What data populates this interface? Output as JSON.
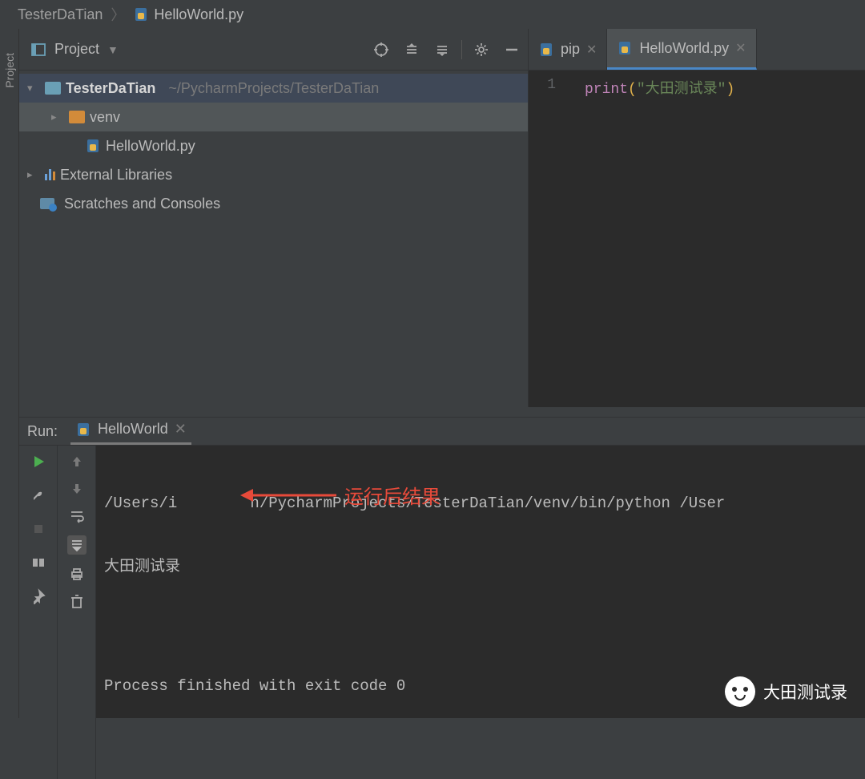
{
  "breadcrumb": {
    "root": "TesterDaTian",
    "file": "HelloWorld.py"
  },
  "leftRail": {
    "label": "Project"
  },
  "projectToolbar": {
    "title": "Project"
  },
  "tree": {
    "root": {
      "name": "TesterDaTian",
      "path": "~/PycharmProjects/TesterDaTian"
    },
    "venv": "venv",
    "file": "HelloWorld.py",
    "external": "External Libraries",
    "scratches": "Scratches and Consoles"
  },
  "editor": {
    "tabs": [
      {
        "label": "pip"
      },
      {
        "label": "HelloWorld.py"
      }
    ],
    "lineNo": "1",
    "code": {
      "fn": "print",
      "lp": "(",
      "str": "\"大田测试录\"",
      "rp": ")"
    }
  },
  "run": {
    "title": "Run:",
    "tabLabel": "HelloWorld",
    "lines": {
      "cmd": "/Users/i        n/PycharmProjects/TesterDaTian/venv/bin/python /User",
      "out": "大田测试录",
      "blank": "",
      "exit": "Process finished with exit code 0"
    },
    "annotation": "运行后结果"
  },
  "watermark": "大田测试录"
}
